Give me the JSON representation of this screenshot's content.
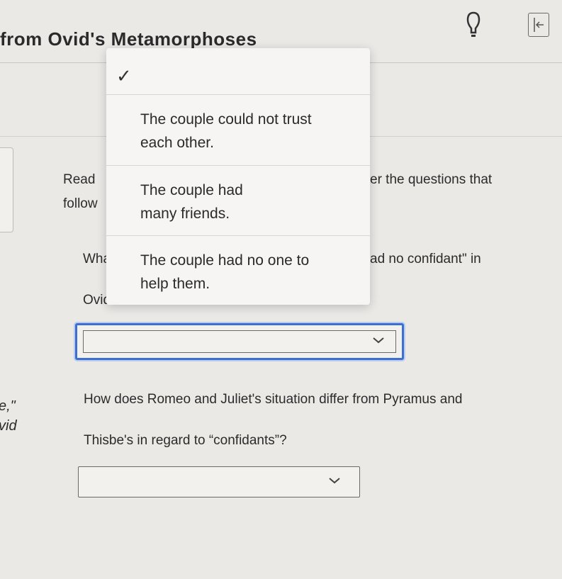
{
  "header": {
    "title": "from Ovid's Metamorphoses",
    "hint_icon": "lightbulb-icon",
    "collapse_icon": "collapse-panel-icon"
  },
  "instructions": {
    "read_fragment": "Read",
    "read_fragment_right": "er the questions that",
    "follow_fragment": "follow"
  },
  "question1": {
    "fragment_left": "Wha",
    "fragment_right": "ad no confidant\" in",
    "ovid_fragment": "Ovid"
  },
  "dropdown_menu": {
    "check_icon": "checkmark-icon",
    "options": [
      {
        "line1": "The couple could not trust",
        "line2": "each other."
      },
      {
        "line1": "The couple had",
        "line2": "many friends."
      },
      {
        "line1": "The couple had no one to",
        "line2": "help them."
      }
    ]
  },
  "question2": {
    "left_fragment_1": "e,\"",
    "left_fragment_2": "vid",
    "line1": "How does Romeo and Juliet's situation differ from Pyramus and",
    "line2": "Thisbe's in regard to “confidants”?"
  },
  "answer_selects": [
    {
      "value": "",
      "icon": "chevron-down-icon"
    },
    {
      "value": "",
      "icon": "chevron-down-icon"
    }
  ]
}
